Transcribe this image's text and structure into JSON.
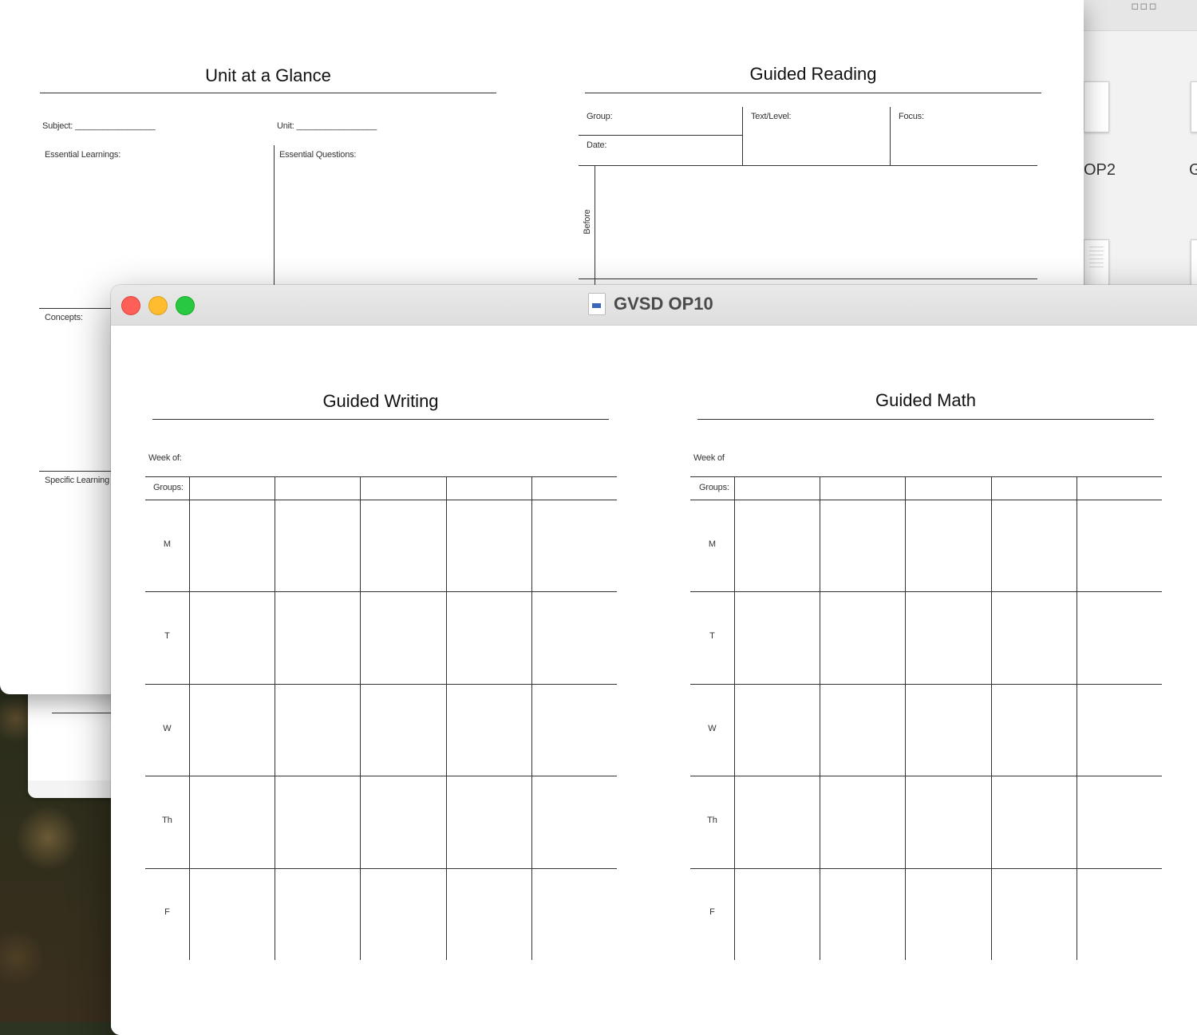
{
  "background_windows": {
    "right_thumbnails": {
      "label_1": "OP2",
      "label_2": "G"
    }
  },
  "unit_at_a_glance": {
    "title": "Unit at a Glance",
    "subject_label": "Subject: _________________",
    "unit_label": "Unit: _________________",
    "essential_learnings": "Essential Learnings:",
    "essential_questions": "Essential Questions:",
    "concepts": "Concepts:",
    "specific_learning": "Specific Learning"
  },
  "guided_reading": {
    "title": "Guided Reading",
    "group": "Group:",
    "text_level": "Text/Level:",
    "focus": "Focus:",
    "date": "Date:",
    "before": "Before"
  },
  "front_window": {
    "title": "GVSD OP10",
    "guided_writing": {
      "title": "Guided Writing",
      "week_of": "Week of:",
      "groups": "Groups:",
      "days": [
        "M",
        "T",
        "W",
        "Th",
        "F"
      ]
    },
    "guided_math": {
      "title": "Guided Math",
      "week_of": "Week of",
      "groups": "Groups:",
      "days": [
        "M",
        "T",
        "W",
        "Th",
        "F"
      ]
    }
  }
}
